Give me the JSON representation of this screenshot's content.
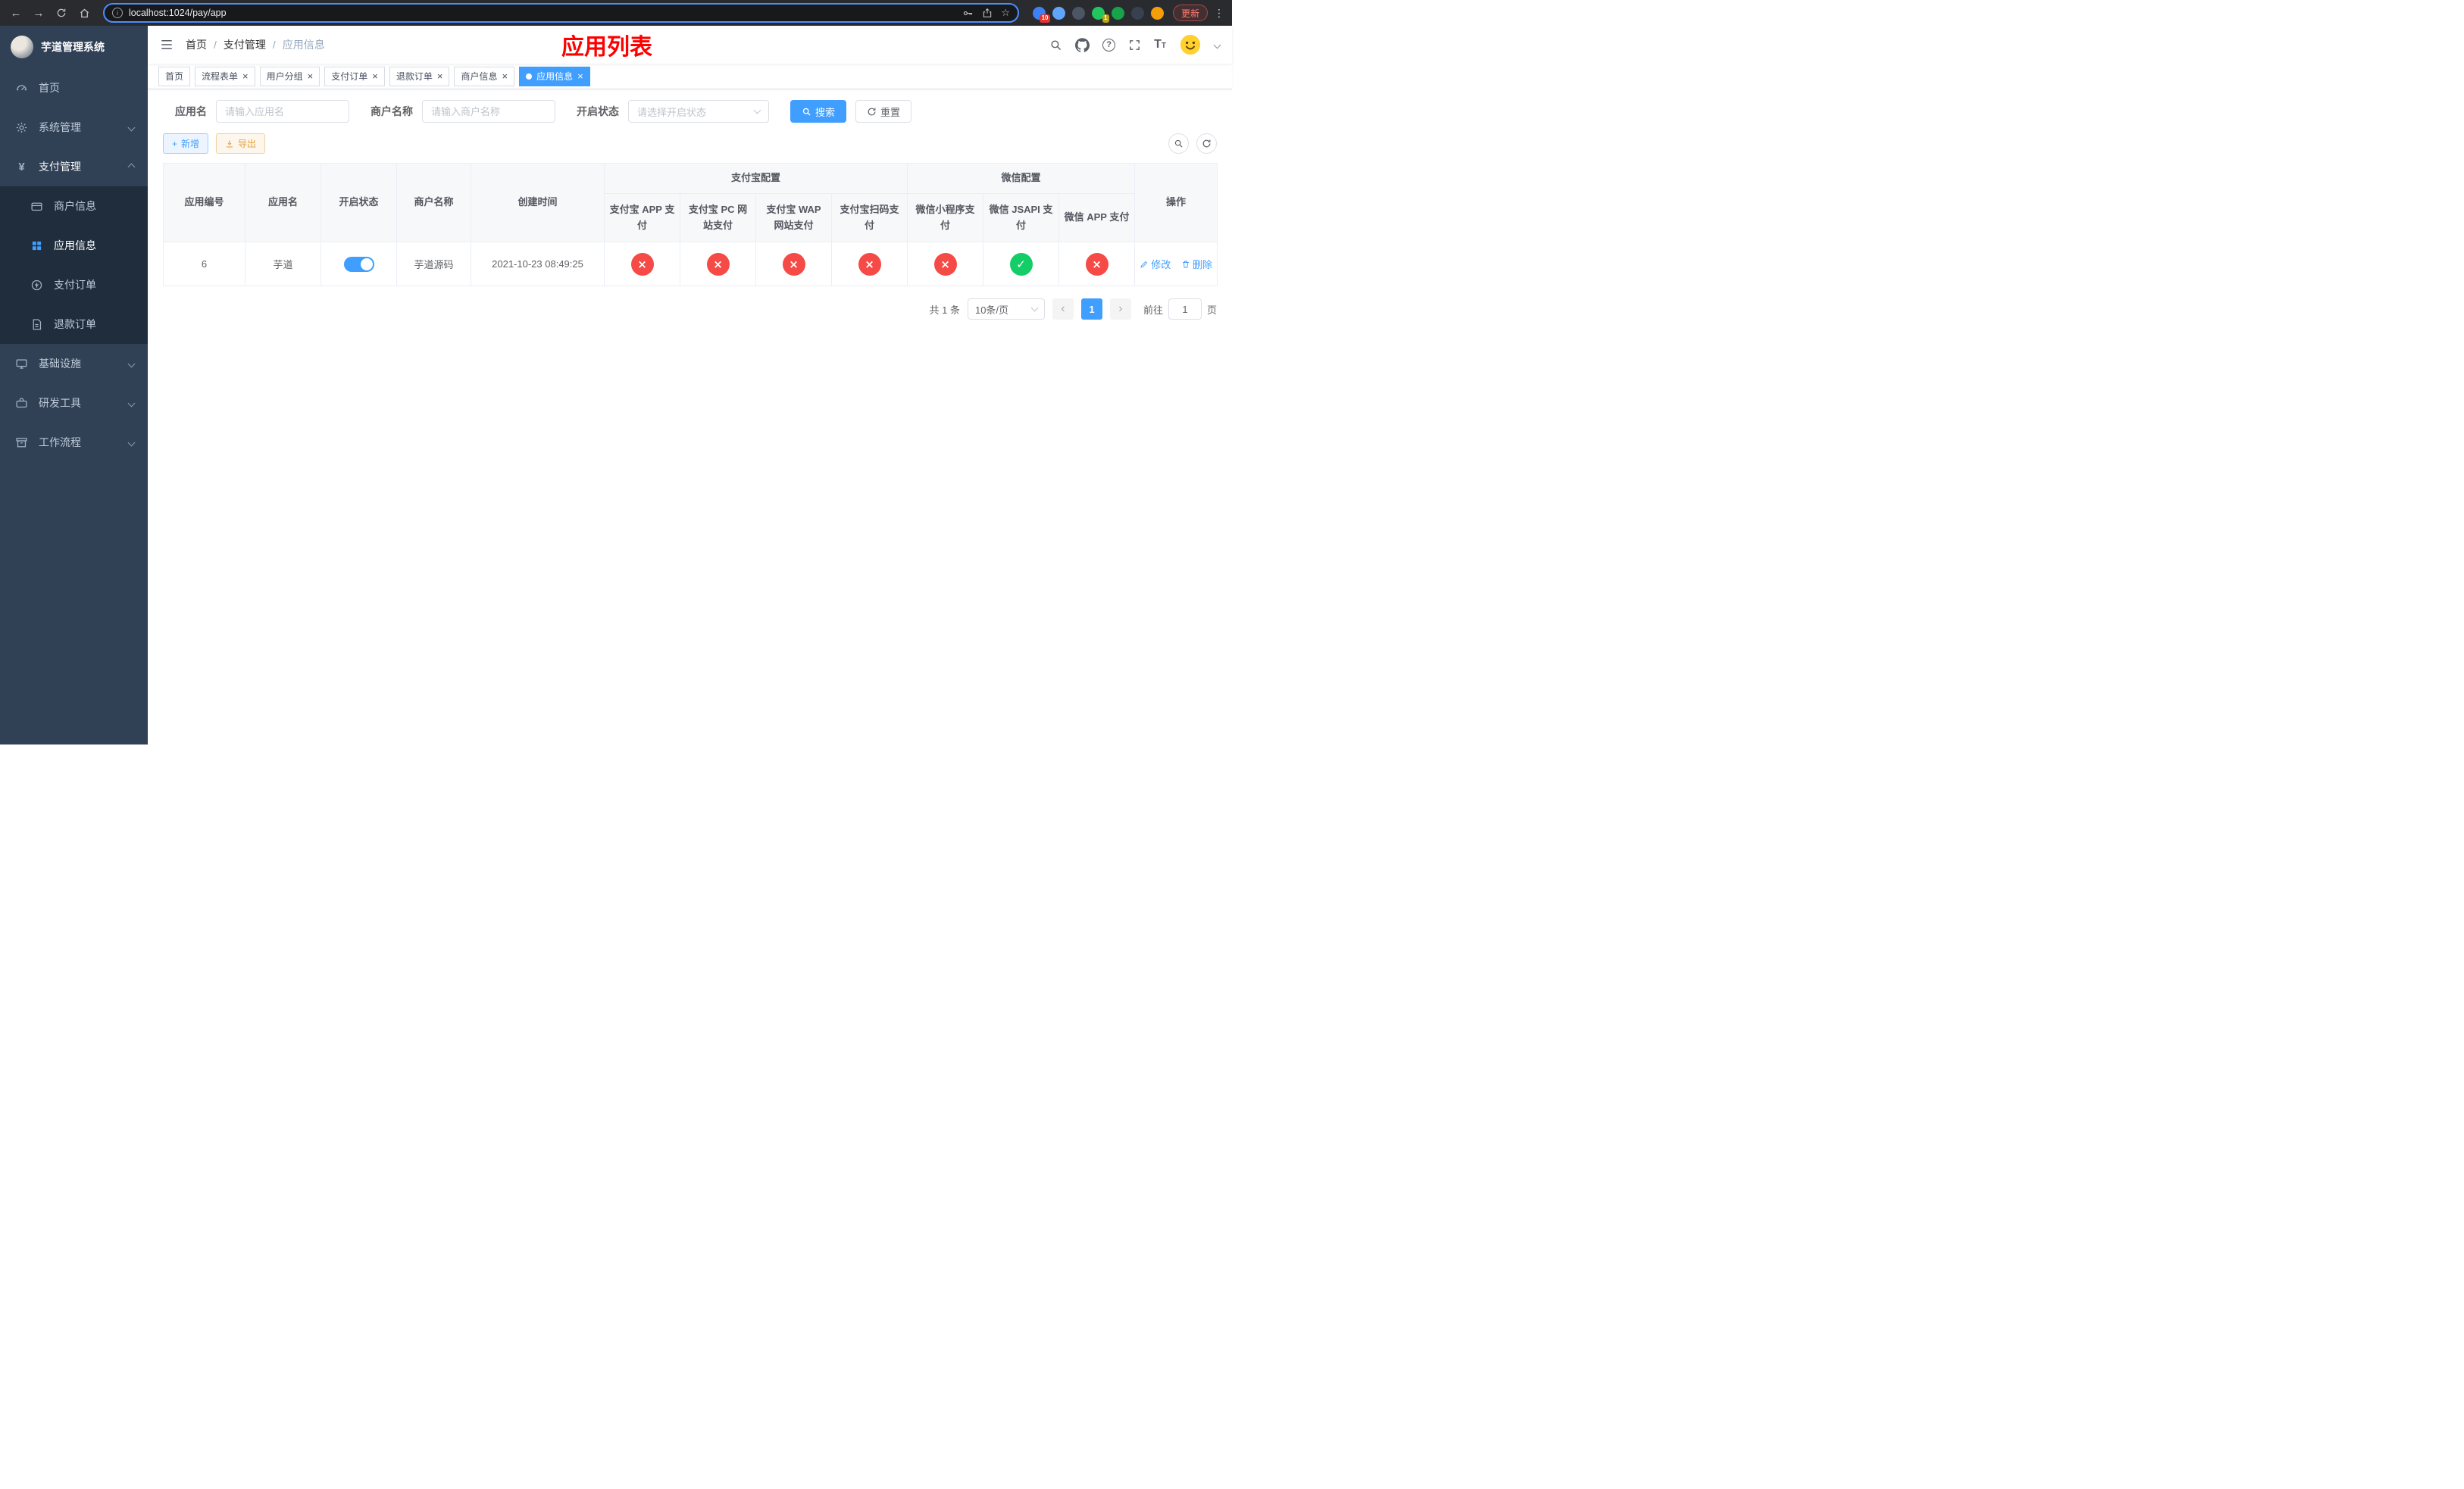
{
  "colors": {
    "primary": "#409eff",
    "success": "#13ce66",
    "danger": "#f54a45",
    "warning": "#e6a23c",
    "page_title_red": "#ff0000",
    "sidebar_bg": "#304156",
    "submenu_bg": "#1f2d3d"
  },
  "browser": {
    "url": "localhost:1024/pay/app",
    "update_label": "更新",
    "ext_badge_1": "10",
    "ext_badge_2": "1"
  },
  "sidebar": {
    "app_title": "芋道管理系统",
    "home": "首页",
    "system": "系统管理",
    "payment": "支付管理",
    "merchant_info": "商户信息",
    "app_info": "应用信息",
    "pay_order": "支付订单",
    "refund_order": "退款订单",
    "infrastructure": "基础设施",
    "dev_tools": "研发工具",
    "workflow": "工作流程"
  },
  "navbar": {
    "breadcrumb": [
      "首页",
      "支付管理",
      "应用信息"
    ],
    "page_title": "应用列表"
  },
  "tabs": [
    {
      "label": "首页",
      "closable": false,
      "active": false
    },
    {
      "label": "流程表单",
      "closable": true,
      "active": false
    },
    {
      "label": "用户分组",
      "closable": true,
      "active": false
    },
    {
      "label": "支付订单",
      "closable": true,
      "active": false
    },
    {
      "label": "退款订单",
      "closable": true,
      "active": false
    },
    {
      "label": "商户信息",
      "closable": true,
      "active": false
    },
    {
      "label": "应用信息",
      "closable": true,
      "active": true
    }
  ],
  "filters": {
    "app_name_label": "应用名",
    "app_name_placeholder": "请输入应用名",
    "merchant_label": "商户名称",
    "merchant_placeholder": "请输入商户名称",
    "status_label": "开启状态",
    "status_placeholder": "请选择开启状态",
    "search_label": "搜索",
    "reset_label": "重置"
  },
  "toolbar": {
    "add_label": "新增",
    "export_label": "导出"
  },
  "table": {
    "col_app_id": "应用编号",
    "col_app_name": "应用名",
    "col_status": "开启状态",
    "col_merchant": "商户名称",
    "col_created": "创建时间",
    "group_alipay": "支付宝配置",
    "group_wechat": "微信配置",
    "col_alipay_app": "支付宝 APP 支付",
    "col_alipay_pc": "支付宝 PC 网站支付",
    "col_alipay_wap": "支付宝 WAP 网站支付",
    "col_alipay_qr": "支付宝扫码支付",
    "col_wx_lite": "微信小程序支付",
    "col_wx_jsapi": "微信 JSAPI 支付",
    "col_wx_app": "微信 APP 支付",
    "col_actions": "操作",
    "rows": [
      {
        "app_id": "6",
        "app_name": "芋道",
        "enabled": "on",
        "merchant": "芋道源码",
        "created": "2021-10-23 08:49:25",
        "alipay_app": "no",
        "alipay_pc": "no",
        "alipay_wap": "no",
        "alipay_qr": "no",
        "wx_lite": "no",
        "wx_jsapi": "yes",
        "wx_app": "no",
        "edit_label": "修改",
        "delete_label": "删除"
      }
    ]
  },
  "pagination": {
    "total": "共 1 条",
    "page_size": "10条/页",
    "page": "1",
    "goto_label": "前往",
    "goto_value": "1",
    "goto_suffix": "页"
  }
}
